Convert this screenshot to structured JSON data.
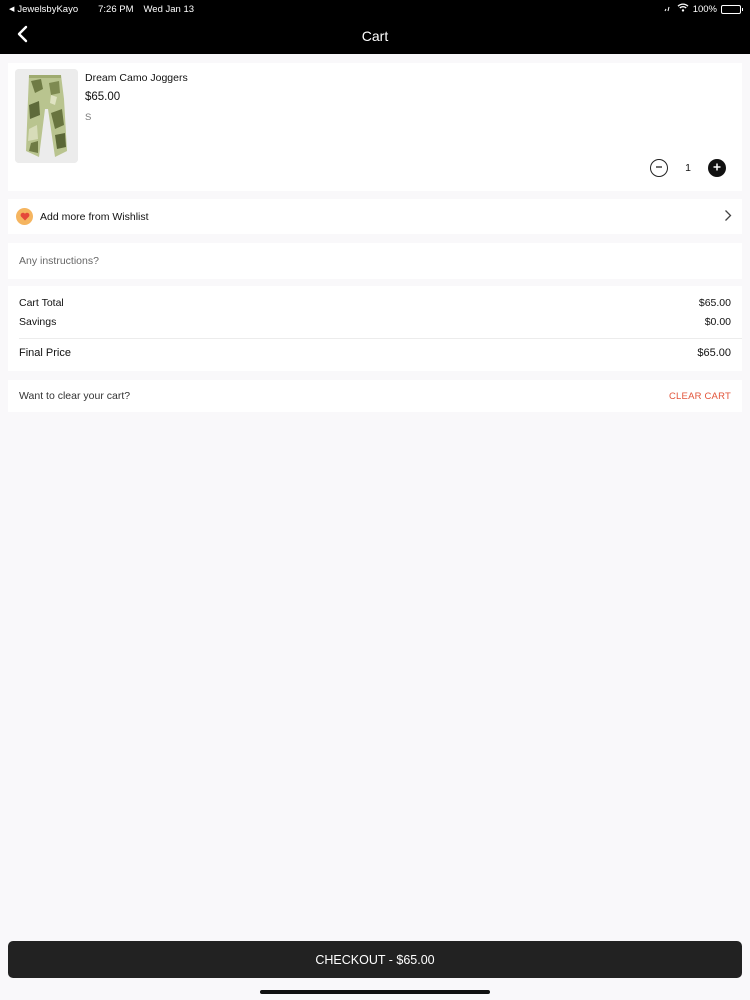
{
  "status_bar": {
    "back_app": "JewelsbyKayo",
    "time": "7:26 PM",
    "date": "Wed Jan 13",
    "battery": "100%"
  },
  "nav": {
    "title": "Cart"
  },
  "cart_item": {
    "name": "Dream Camo Joggers",
    "price": "$65.00",
    "size": "S",
    "quantity": "1"
  },
  "wishlist": {
    "label": "Add more from Wishlist"
  },
  "instructions": {
    "placeholder": "Any instructions?"
  },
  "totals": {
    "cart_total_label": "Cart Total",
    "cart_total_value": "$65.00",
    "savings_label": "Savings",
    "savings_value": "$0.00",
    "final_label": "Final Price",
    "final_value": "$65.00"
  },
  "clear": {
    "prompt": "Want to clear your cart?",
    "button": "CLEAR CART"
  },
  "checkout": {
    "label": "CHECKOUT - $65.00"
  },
  "colors": {
    "accent_clear": "#e2543a",
    "nav_bg": "#000000",
    "checkout_bg": "#222222",
    "heart_badge": "#f5b560"
  },
  "icons": {
    "back": "chevron-left-icon",
    "wishlist": "heart-icon",
    "wishlist_arrow": "chevron-right-icon",
    "qty_minus": "minus-circle-icon",
    "qty_plus": "plus-circle-icon"
  }
}
